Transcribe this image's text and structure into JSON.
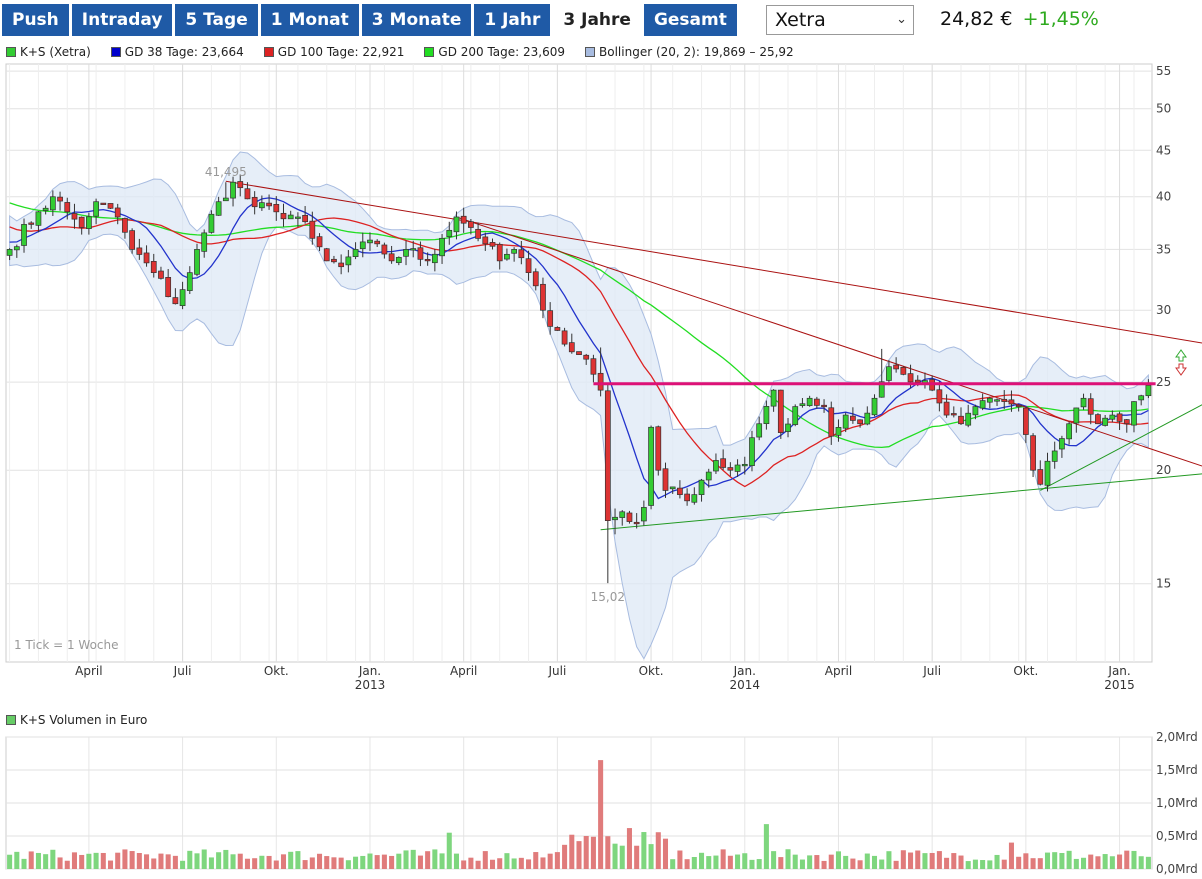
{
  "tabs": [
    {
      "label": "Push",
      "active": false
    },
    {
      "label": "Intraday",
      "active": false
    },
    {
      "label": "5 Tage",
      "active": false
    },
    {
      "label": "1 Monat",
      "active": false
    },
    {
      "label": "3 Monate",
      "active": false
    },
    {
      "label": "1 Jahr",
      "active": false
    },
    {
      "label": "3 Jahre",
      "active": true
    },
    {
      "label": "Gesamt",
      "active": false
    }
  ],
  "exchange": {
    "selected": "Xetra"
  },
  "quote": {
    "price": "24,82 €",
    "change": "+1,45%"
  },
  "legend": [
    {
      "label": "K+S (Xetra)",
      "color": "#33cc33"
    },
    {
      "label": "GD 38 Tage: 23,664",
      "color": "#0000cc"
    },
    {
      "label": "GD 100 Tage: 22,921",
      "color": "#dd2222"
    },
    {
      "label": "GD 200 Tage: 23,609",
      "color": "#22dd22"
    },
    {
      "label": "Bollinger (20, 2): 19,869 – 25,92",
      "color": "#a8bce0"
    }
  ],
  "volume_legend": {
    "label": "K+S Volumen in Euro",
    "color": "#66cc66"
  },
  "colors": {
    "up": "#33cc33",
    "down": "#dd3333",
    "ma38": "#2233cc",
    "ma100": "#dd2222",
    "ma200": "#22dd22",
    "bollinger_fill": "#dde8f6",
    "bollinger_line": "#a8bce0",
    "resistance": "#dd1177",
    "trend_red": "#aa1111",
    "trend_green": "#229922",
    "vol_up": "#7ed67e",
    "vol_down": "#e07b7b"
  },
  "chart_data": [
    {
      "type": "candlestick",
      "scale": "log",
      "ylim": [
        12.3,
        56
      ],
      "y_ticks": [
        15,
        20,
        25,
        30,
        35,
        40,
        45,
        50,
        55
      ],
      "x_ticks": [
        {
          "label": "April",
          "week": 11
        },
        {
          "label": "Juli",
          "week": 24
        },
        {
          "label": "Okt.",
          "week": 37
        },
        {
          "label": "Jan.",
          "week": 50,
          "year": "2013"
        },
        {
          "label": "April",
          "week": 63
        },
        {
          "label": "Juli",
          "week": 76
        },
        {
          "label": "Okt.",
          "week": 89
        },
        {
          "label": "Jan.",
          "week": 102,
          "year": "2014"
        },
        {
          "label": "April",
          "week": 115
        },
        {
          "label": "Juli",
          "week": 128
        },
        {
          "label": "Okt.",
          "week": 141
        },
        {
          "label": "Jan.",
          "week": 154,
          "year": "2015"
        }
      ],
      "annotations": [
        {
          "label": "41,495",
          "week": 30,
          "value": 41.5
        },
        {
          "label": "15,02",
          "week": 83,
          "value": 15.02
        }
      ],
      "note": "1 Tick = 1 Woche",
      "keypoints": [
        [
          0,
          35.0
        ],
        [
          4,
          38.5
        ],
        [
          6,
          40.0
        ],
        [
          8,
          38.5
        ],
        [
          10,
          37.0
        ],
        [
          12,
          39.5
        ],
        [
          15,
          38.0
        ],
        [
          17,
          35.0
        ],
        [
          20,
          33.0
        ],
        [
          23,
          30.5
        ],
        [
          25,
          33.0
        ],
        [
          27,
          36.5
        ],
        [
          29,
          39.5
        ],
        [
          31,
          41.5
        ],
        [
          34,
          39.0
        ],
        [
          37,
          38.5
        ],
        [
          40,
          38.0
        ],
        [
          42,
          36.0
        ],
        [
          44,
          34.0
        ],
        [
          46,
          33.5
        ],
        [
          48,
          35.0
        ],
        [
          51,
          35.5
        ],
        [
          53,
          34.0
        ],
        [
          55,
          35.0
        ],
        [
          58,
          34.0
        ],
        [
          60,
          36.0
        ],
        [
          62,
          38.0
        ],
        [
          64,
          37.0
        ],
        [
          66,
          35.5
        ],
        [
          68,
          34.0
        ],
        [
          70,
          35.0
        ],
        [
          72,
          33.0
        ],
        [
          74,
          30.0
        ],
        [
          76,
          28.5
        ],
        [
          78,
          27.0
        ],
        [
          80,
          26.5
        ],
        [
          82,
          24.5
        ],
        [
          83,
          17.6
        ],
        [
          85,
          18.0
        ],
        [
          87,
          17.5
        ],
        [
          88,
          18.2
        ],
        [
          89,
          22.3
        ],
        [
          90,
          20.0
        ],
        [
          91,
          19.0
        ],
        [
          93,
          18.8
        ],
        [
          95,
          18.8
        ],
        [
          96,
          19.5
        ],
        [
          98,
          20.5
        ],
        [
          100,
          20.0
        ],
        [
          102,
          20.3
        ],
        [
          104,
          22.5
        ],
        [
          106,
          24.5
        ],
        [
          107,
          22.0
        ],
        [
          109,
          23.5
        ],
        [
          111,
          24.0
        ],
        [
          113,
          23.5
        ],
        [
          114,
          21.8
        ],
        [
          116,
          23.0
        ],
        [
          118,
          22.5
        ],
        [
          120,
          24.0
        ],
        [
          122,
          26.0
        ],
        [
          124,
          25.5
        ],
        [
          126,
          25.0
        ],
        [
          128,
          24.5
        ],
        [
          130,
          23.0
        ],
        [
          132,
          22.5
        ],
        [
          134,
          23.5
        ],
        [
          136,
          24.0
        ],
        [
          138,
          23.8
        ],
        [
          140,
          23.5
        ],
        [
          142,
          20.0
        ],
        [
          143,
          19.3
        ],
        [
          145,
          21.0
        ],
        [
          147,
          22.5
        ],
        [
          149,
          24.0
        ],
        [
          151,
          22.5
        ],
        [
          153,
          23.0
        ],
        [
          155,
          22.5
        ],
        [
          156,
          23.8
        ],
        [
          158,
          24.8
        ]
      ],
      "overlays": {
        "resistance": {
          "value": 24.9,
          "from_week": 81,
          "to_week": 159
        },
        "trend_red_1": {
          "points": [
            [
              30,
              41.6
            ],
            [
              168,
              27.4
            ]
          ]
        },
        "trend_red_2": {
          "points": [
            [
              62,
              38.0
            ],
            [
              168,
              19.9
            ]
          ]
        },
        "trend_green_1": {
          "points": [
            [
              82,
              17.2
            ],
            [
              168,
              19.9
            ]
          ]
        },
        "trend_green_2": {
          "points": [
            [
              143,
              19.0
            ],
            [
              168,
              24.2
            ]
          ]
        }
      }
    },
    {
      "type": "bar",
      "title": "K+S Volumen in Euro",
      "y_ticks": [
        "0,0Mrd",
        "0,5Mrd",
        "1,0Mrd",
        "1,5Mrd",
        "2,0Mrd"
      ],
      "ylim": [
        0,
        2.0
      ],
      "unit": "Mrd",
      "peak": {
        "week": 82,
        "value": 1.65
      }
    }
  ]
}
